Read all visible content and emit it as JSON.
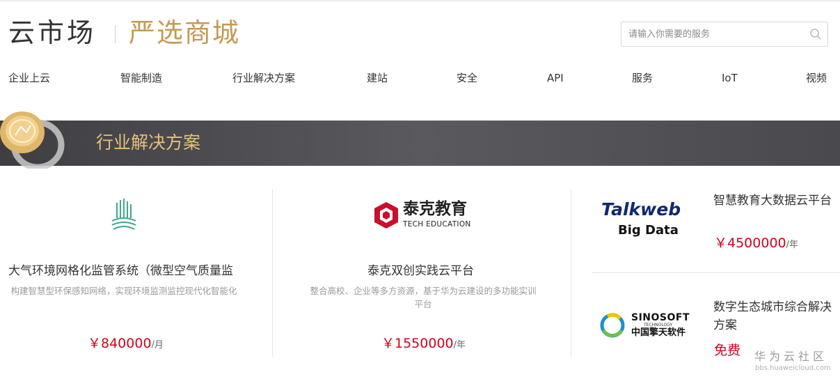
{
  "header": {
    "logo_main": "云市场",
    "logo_sub": "严选商城",
    "search_placeholder": "请输入你需要的服务"
  },
  "nav": {
    "items": [
      "企业上云",
      "智能制造",
      "行业解决方案",
      "建站",
      "安全",
      "API",
      "服务",
      "IoT",
      "视频"
    ]
  },
  "banner": {
    "title": "行业解决方案"
  },
  "cards": [
    {
      "title": "大气环境网格化监管系统（微型空气质量监",
      "desc": "构建智慧型环保感知网络，实现环境监测监控现代化智能化",
      "price": "￥840000",
      "unit": "/月"
    },
    {
      "logo_cn": "泰克教育",
      "logo_en": "TECH EDUCATION",
      "title": "泰克双创实践云平台",
      "desc": "整合高校、企业等多方资源，基于华为云建设的多功能实训平台",
      "price": "￥1550000",
      "unit": "/年"
    }
  ],
  "side_cards": [
    {
      "logo_line1": "Talkweb",
      "logo_line2": "Big Data",
      "title": "智慧教育大数据云平台",
      "price": "￥4500000",
      "unit": "/年"
    },
    {
      "logo_line1": "SINOSOFT",
      "logo_line2": "TECHNOLOGY",
      "logo_line3": "中国擎天软件",
      "title": "数字生态城市综合解决方案",
      "price": "免费"
    }
  ],
  "watermark": {
    "main": "华为云社区",
    "sub": "bbs.huaweicloud.com"
  },
  "colors": {
    "accent_gold": "#c39a55",
    "banner_text": "#e6c07a",
    "price_red": "#d0021b",
    "banner_bg": "#4d4d51"
  }
}
